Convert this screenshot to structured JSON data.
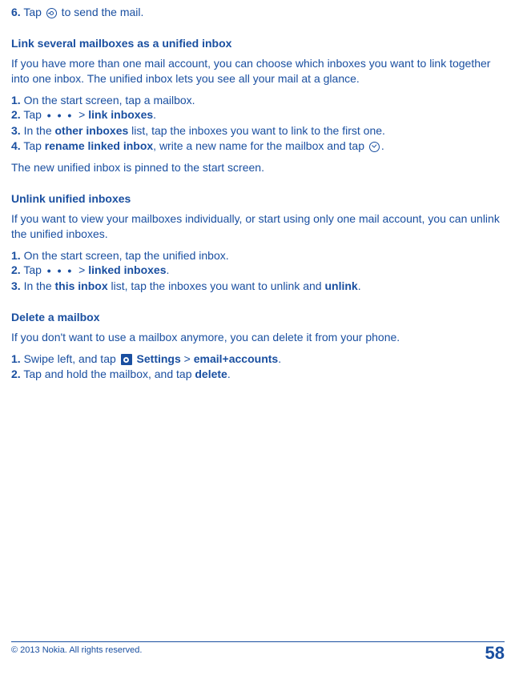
{
  "top": {
    "step6_prefix": "6.",
    "step6_a": " Tap ",
    "step6_b": " to send the mail."
  },
  "sec1": {
    "heading": "Link several mailboxes as a unified inbox",
    "intro": "If you have more than one mail account, you can choose which inboxes you want to link together into one inbox. The unified inbox lets you see all your mail at a glance.",
    "s1p": "1.",
    "s1t": " On the start screen, tap a mailbox.",
    "s2p": "2.",
    "s2a": " Tap ",
    "s2gt": " > ",
    "s2link": "link inboxes",
    "s2dot": ".",
    "s3p": "3.",
    "s3a": " In the ",
    "s3b": "other inboxes",
    "s3c": " list, tap the inboxes you want to link to the first one.",
    "s4p": "4.",
    "s4a": " Tap ",
    "s4b": "rename linked inbox",
    "s4c": ", write a new name for the mailbox and tap ",
    "s4d": ".",
    "outro": "The new unified inbox is pinned to the start screen."
  },
  "sec2": {
    "heading": "Unlink unified inboxes",
    "intro": "If you want to view your mailboxes individually, or start using only one mail account, you can unlink the unified inboxes.",
    "s1p": "1.",
    "s1t": " On the start screen, tap the unified inbox.",
    "s2p": "2.",
    "s2a": " Tap ",
    "s2gt": " > ",
    "s2link": "linked inboxes",
    "s2dot": ".",
    "s3p": "3.",
    "s3a": " In the ",
    "s3b": "this inbox",
    "s3c": " list, tap the inboxes you want to unlink and ",
    "s3d": "unlink",
    "s3e": "."
  },
  "sec3": {
    "heading": "Delete a mailbox",
    "intro": "If you don't want to use a mailbox anymore, you can delete it from your phone.",
    "s1p": "1.",
    "s1a": " Swipe left, and tap ",
    "s1b": " Settings",
    "s1gt": " > ",
    "s1c": "email+accounts",
    "s1d": ".",
    "s2p": "2.",
    "s2a": " Tap and hold the mailbox, and tap ",
    "s2b": "delete",
    "s2c": "."
  },
  "footer": {
    "copyright": "© 2013 Nokia. All rights reserved.",
    "page": "58"
  },
  "dots": "• • •"
}
